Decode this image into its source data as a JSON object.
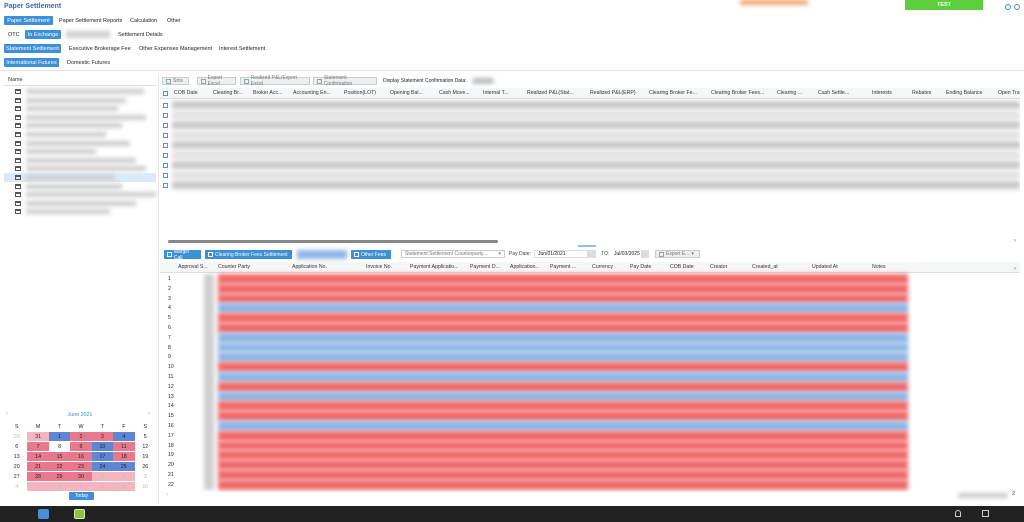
{
  "app": {
    "title": "Paper Settlement",
    "env_badge": "TEST"
  },
  "nav_tabs": [
    {
      "label": "Paper Settlement",
      "active": true
    },
    {
      "label": "Paper Settlement Reports",
      "active": false
    },
    {
      "label": "Calculation",
      "active": false
    },
    {
      "label": "Other",
      "active": false
    }
  ],
  "sub_tabs": [
    {
      "label": "OTC",
      "active": false
    },
    {
      "label": "In Exchange",
      "active": true
    },
    {
      "label": "Settlement Details",
      "active": false
    }
  ],
  "settle_tabs": [
    {
      "label": "Statement Settlement",
      "active": true
    },
    {
      "label": "Executive Brokerage Fee",
      "active": false
    },
    {
      "label": "Other Expenses Management",
      "active": false
    },
    {
      "label": "Interest Settlement",
      "active": false
    }
  ],
  "futures_tabs": [
    {
      "label": "International Futures",
      "active": true
    },
    {
      "label": "Domestic Futures",
      "active": false
    }
  ],
  "tree": {
    "header": "Name",
    "item_count": 15
  },
  "top_toolbar": {
    "sms": "Sms",
    "export_excel": "Export Excel",
    "realized_export": "Realized P&L/Export Excel",
    "statement_confirmation": "Statement Confirmation",
    "display_label": "Display Statement Confirmation Data:"
  },
  "top_columns": [
    "COB Date",
    "Clearing Br...",
    "Broker Acc...",
    "Accounting En...",
    "Position(LOT)",
    "Opening Bal...",
    "Cash Move...",
    "Internal T...",
    "Realized P&L(Stat...",
    "Realized P&L(ERP)",
    "Clearing Broker Fe...",
    "Clearing Broker Fees...",
    "Clearing ...",
    "Cash Settle...",
    "Interests",
    "Rebates",
    "Ending Balance",
    "Open Tra"
  ],
  "bottom_toolbar": {
    "margin_call": "Margin Call",
    "clearing_fees": "Clearing Broker Fees Settlement",
    "other_fees": "Other Fees",
    "counterparty_placeholder": "Statement Settlement Counterparty...",
    "pay_date_label": "Pay Date:",
    "pay_from": "Jun/01/2021",
    "to_label": "TO:",
    "pay_to": "Jul/03/2025",
    "export": "Export E..."
  },
  "bottom_columns": [
    "Approval S...",
    "Counter Party",
    "Application No.",
    "Invoice No.",
    "Payment Applicatio...",
    "Payment D...",
    "Application...",
    "Payment ...",
    "Currency",
    "Pay Date",
    "COB Date",
    "Creator",
    "Created_at",
    "Updated At",
    "Notes"
  ],
  "row_numbers": [
    "1",
    "2",
    "3",
    "4",
    "5",
    "6",
    "7",
    "8",
    "9",
    "10",
    "11",
    "12",
    "13",
    "14",
    "15",
    "16",
    "17",
    "18",
    "19",
    "20",
    "21",
    "22"
  ],
  "pagination": {
    "page_indicator": "2"
  },
  "calendar": {
    "month_label": "June 2021",
    "weekdays": [
      "S",
      "M",
      "T",
      "W",
      "T",
      "F",
      "S"
    ],
    "weeks": [
      [
        "30",
        "31",
        "1",
        "2",
        "3",
        "4",
        "5"
      ],
      [
        "6",
        "7",
        "8",
        "9",
        "10",
        "11",
        "12"
      ],
      [
        "13",
        "14",
        "15",
        "16",
        "17",
        "18",
        "19"
      ],
      [
        "20",
        "21",
        "22",
        "23",
        "24",
        "25",
        "26"
      ],
      [
        "27",
        "28",
        "29",
        "30",
        "1",
        "2",
        "3"
      ],
      [
        "4",
        "5",
        "6",
        "7",
        "8",
        "9",
        "10"
      ]
    ],
    "today_label": "Today"
  },
  "colors": {
    "accent": "#3d8fd8",
    "red_row": "#f06a6a",
    "blue_row": "#8fb6e6",
    "badge": "#5ccd3c"
  }
}
